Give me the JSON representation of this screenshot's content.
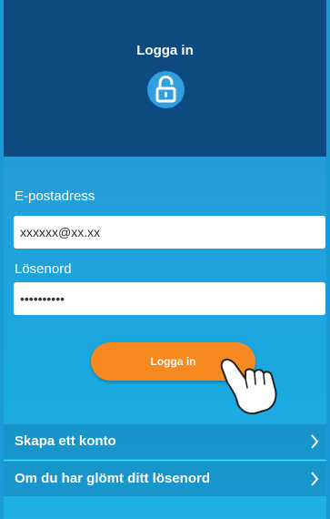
{
  "header": {
    "title": "Logga in",
    "icon": "unlocked-padlock-icon"
  },
  "form": {
    "email_label": "E-postadress",
    "email_value": "xxxxxx@xx.xx",
    "password_label": "Lösenord",
    "password_value": "••••••••••"
  },
  "login_button": {
    "label": "Logga in"
  },
  "links": [
    {
      "label": "Skapa ett konto",
      "icon": "chevron-right-icon"
    },
    {
      "label": "Om du har glömt ditt lösenord",
      "icon": "chevron-right-icon"
    }
  ],
  "colors": {
    "header_bg": "#0d4a7f",
    "body_bg": "#239fda",
    "accent_button": "#f6891f",
    "lock_circle": "#2f9fe0"
  }
}
